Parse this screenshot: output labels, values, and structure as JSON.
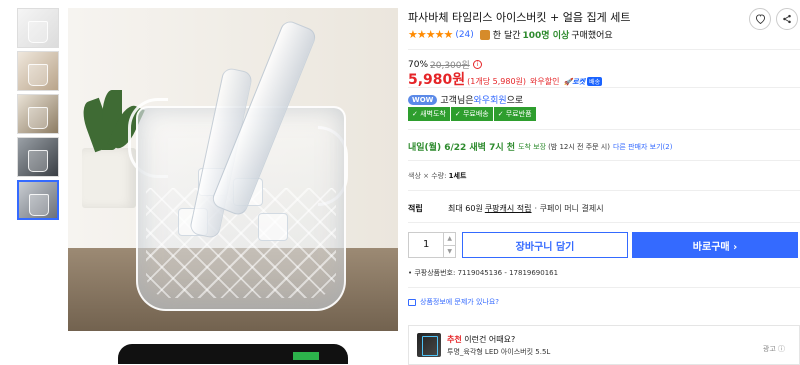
{
  "product": {
    "title": "파사바체 타임리스 아이스버킷 + 얼음 집게 세트",
    "rating_stars": "★★★★★",
    "review_count": "(24)",
    "bought_prefix": "한 달간",
    "bought_highlight": "100명 이상",
    "bought_suffix": "구매했어요"
  },
  "price": {
    "discount_rate": "70%",
    "original": "20,300원",
    "sale": "5,980원",
    "unit_price": "(1개당 5,980원)",
    "wow_label": "와우할인",
    "rocket_label": "로켓",
    "rocket_badge": "배송"
  },
  "wow": {
    "badge": "WOW",
    "text_prefix": "고객님은",
    "member_link": "와우회원",
    "text_suffix": "으로",
    "benefits": [
      "✓ 새벽도착",
      "✓ 무료배송",
      "✓ 무료반품"
    ]
  },
  "delivery": {
    "date": "내일(월) 6/22 새벽 7시 천",
    "guarantee": "도착 보장",
    "note": "(밤 12시 전 주문 시)",
    "other_sellers": "다른 판매자 보기(2)"
  },
  "option": {
    "label": "색상 × 수량:",
    "value": "1세트"
  },
  "points": {
    "label": "적립",
    "text": "최대 60원",
    "link": "쿠팡캐시 적립",
    "pay": "· 쿠페이 머니 결제시"
  },
  "purchase": {
    "quantity": "1",
    "cart_label": "장바구니 담기",
    "buy_label": "바로구매 ›"
  },
  "meta": {
    "product_id": "• 쿠팡상품번호: 7119045136 - 17819690161",
    "question": "상품정보에 문제가 있나요?"
  },
  "recommend": {
    "highlight": "추천",
    "title": "이런건 어때요?",
    "item": "투명_육각형 LED 아이스버킷 5.5L",
    "ad_label": "광고 ⓘ"
  },
  "icons": {
    "heart": "heart-icon",
    "share": "share-icon"
  },
  "colors": {
    "accent": "#346aff",
    "price": "#e52528",
    "delivery": "#2e8b2e"
  }
}
